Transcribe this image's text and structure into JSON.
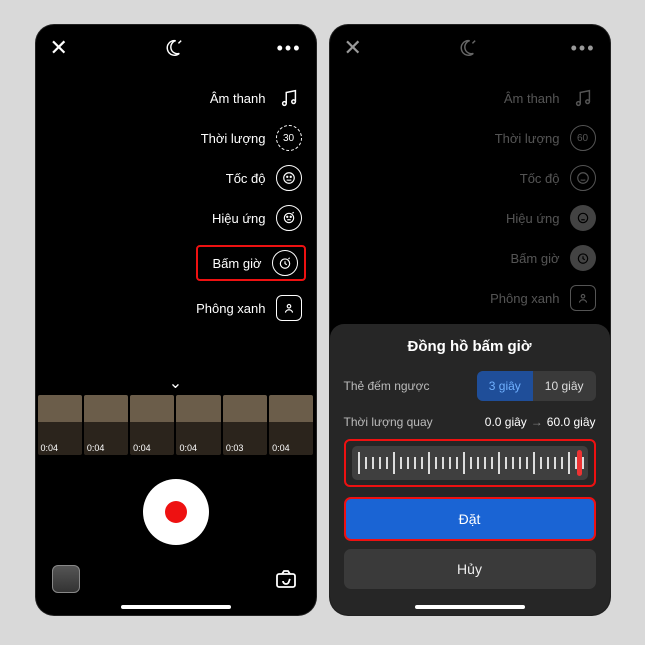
{
  "left": {
    "menu": {
      "sound": "Âm thanh",
      "duration": "Thời lượng",
      "duration_val": "30",
      "speed": "Tốc độ",
      "effect": "Hiệu ứng",
      "timer": "Bấm giờ",
      "greenscreen": "Phông xanh"
    },
    "thumbs": [
      "0:04",
      "0:04",
      "0:04",
      "0:04",
      "0:03",
      "0:04"
    ]
  },
  "right": {
    "menu": {
      "sound": "Âm thanh",
      "duration": "Thời lượng",
      "duration_val": "60",
      "speed": "Tốc độ",
      "effect": "Hiệu ứng",
      "timer": "Bấm giờ",
      "greenscreen": "Phông xanh"
    },
    "sheet": {
      "title": "Đồng hồ bấm giờ",
      "countdown_label": "Thẻ đếm ngược",
      "opt_3s": "3 giây",
      "opt_10s": "10 giây",
      "record_label": "Thời lượng quay",
      "from": "0.0 giây",
      "to": "60.0 giây",
      "set": "Đặt",
      "cancel": "Hủy"
    }
  }
}
